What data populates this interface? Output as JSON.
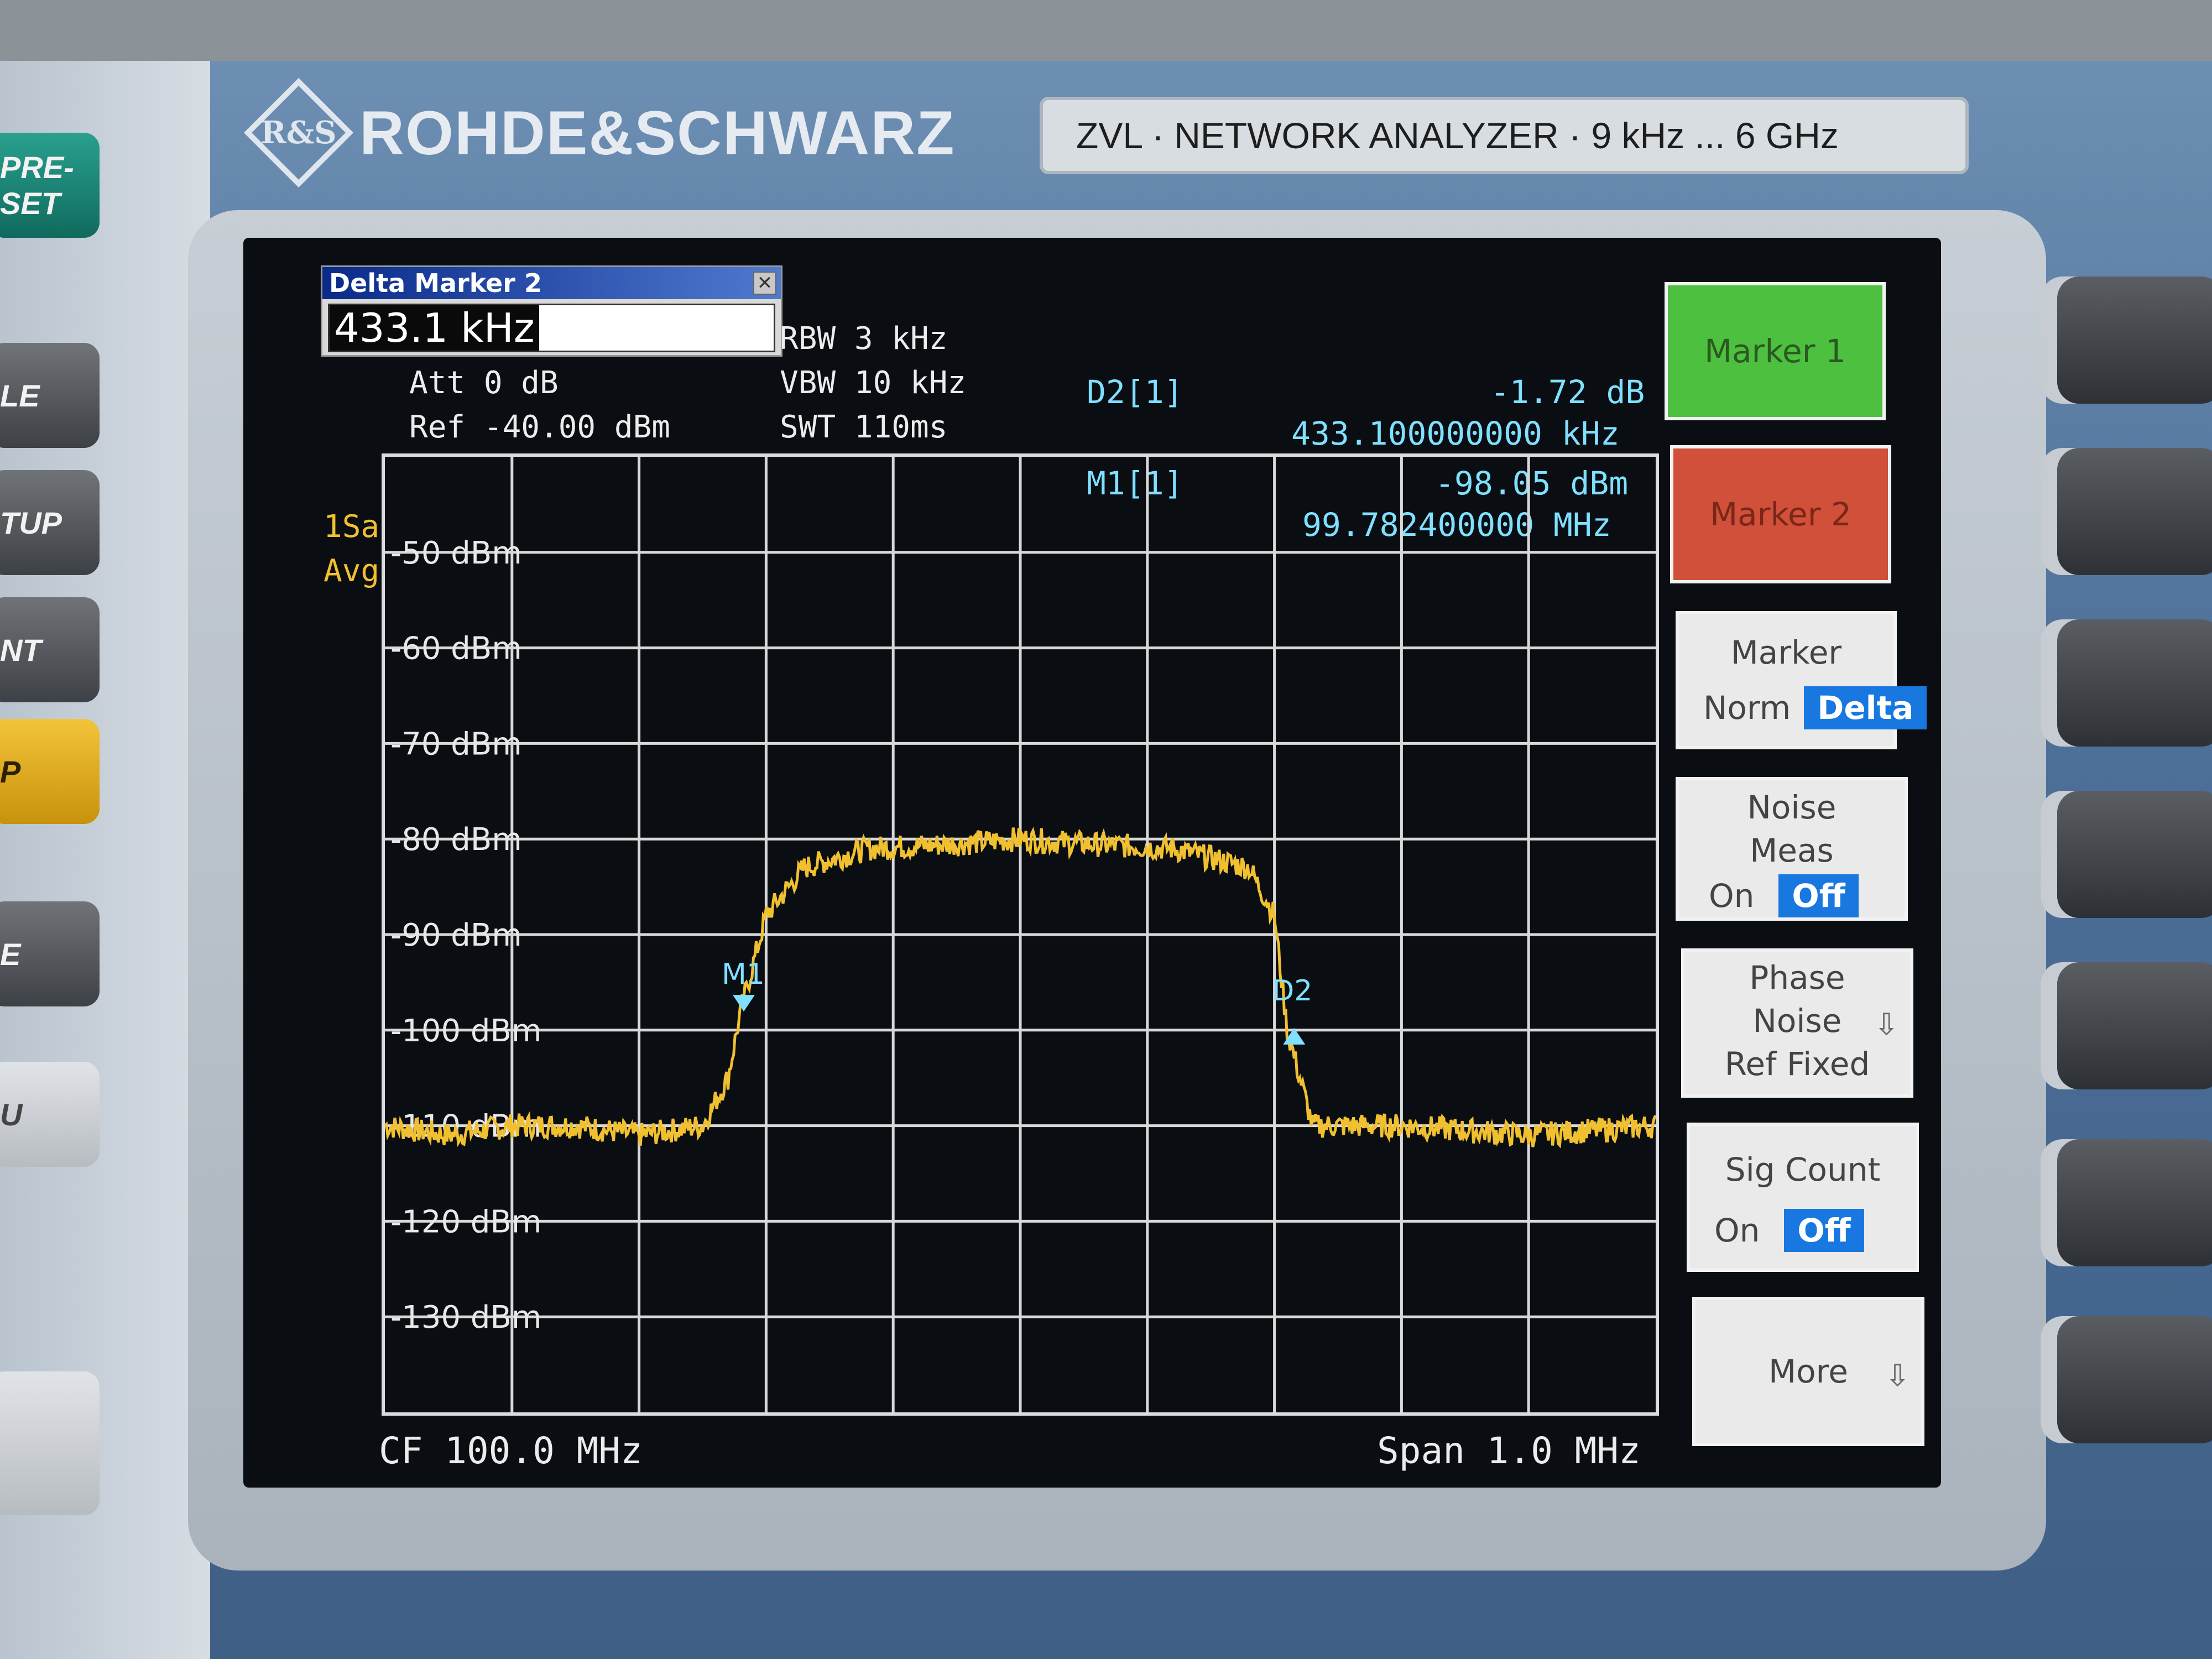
{
  "device": {
    "brand": "ROHDE&SCHWARZ",
    "logo_text": "R&S",
    "model_label": "ZVL · NETWORK ANALYZER · 9 kHz ... 6 GHz"
  },
  "hardware_keys": [
    "PRE-SET",
    "LE",
    "TUP",
    "NT",
    "P",
    "E",
    "U"
  ],
  "dialog": {
    "title": "Delta Marker 2",
    "value": "433.1 kHz"
  },
  "settings": {
    "att": "Att   0 dB",
    "ref": "Ref  -40.00 dBm",
    "rbw": "RBW 3 kHz",
    "vbw": "VBW 10 kHz",
    "swt": "SWT 110ms"
  },
  "trace_info": {
    "line1": "1Sa",
    "line2": "Avg"
  },
  "marker_readouts": [
    {
      "name": "D2[1]",
      "value": "-1.72 dB",
      "position": "433.100000000 kHz"
    },
    {
      "name": "M1[1]",
      "value": "-98.05 dBm",
      "position": "99.782400000 MHz"
    }
  ],
  "footer": {
    "cf": "CF  100.0 MHz",
    "span": "Span  1.0 MHz"
  },
  "softkeys": {
    "marker1": "Marker 1",
    "marker2": "Marker 2",
    "marker_mode": {
      "title": "Marker",
      "options": [
        "Norm",
        "Delta"
      ],
      "selected": "Delta"
    },
    "noise_meas": {
      "title_line1": "Noise",
      "title_line2": "Meas",
      "options": [
        "On",
        "Off"
      ],
      "selected": "Off"
    },
    "phase_noise": {
      "line1": "Phase",
      "line2": "Noise",
      "line3": "Ref Fixed"
    },
    "sig_count": {
      "title": "Sig Count",
      "options": [
        "On",
        "Off"
      ],
      "selected": "Off"
    },
    "more": "More"
  },
  "colors": {
    "trace": "#f0c030",
    "marker1_bg": "#4ec040",
    "marker2_bg": "#d0503a",
    "marker_readout": "#7fe0ff",
    "toggle_selected": "#1878e0"
  },
  "chart_data": {
    "type": "line",
    "xlabel": "",
    "ylabel": "",
    "y_tick_labels": [
      "-50 dBm",
      "-60 dBm",
      "-70 dBm",
      "-80 dBm",
      "-90 dBm",
      "-100 dBm",
      "-110 dBm",
      "-120 dBm",
      "-130 dBm"
    ],
    "ylim": [
      -140,
      -40
    ],
    "xlim": [
      99.5,
      100.5
    ],
    "x_unit": "MHz",
    "grid": true,
    "series": [
      {
        "x": [
          99.5,
          99.55,
          99.6,
          99.65,
          99.7,
          99.75,
          99.77,
          99.78,
          99.8,
          99.83,
          99.88,
          99.95,
          100.0,
          100.05,
          100.12,
          100.18,
          100.2,
          100.21,
          100.23,
          100.3,
          100.4,
          100.5
        ],
        "y": [
          -110,
          -111,
          -110,
          -110,
          -111,
          -110,
          -105,
          -98,
          -88,
          -83,
          -81,
          -80.5,
          -80,
          -80.5,
          -81,
          -83,
          -88,
          -100,
          -110,
          -110,
          -111,
          -110
        ]
      }
    ],
    "markers": [
      {
        "label": "M1",
        "x": 99.7824,
        "y": -98.05
      },
      {
        "label": "D2",
        "x": 100.2155,
        "y": -99.77
      }
    ]
  }
}
